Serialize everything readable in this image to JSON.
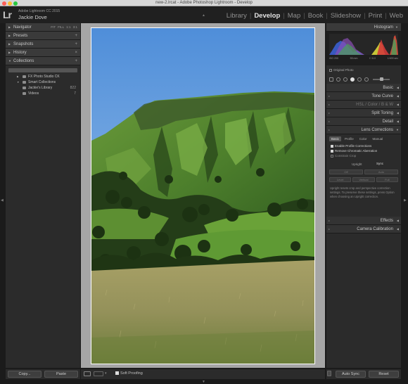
{
  "window": {
    "title": "new-2.lrcat - Adobe Photoshop Lightroom - Develop"
  },
  "identity": {
    "logo": "Lr",
    "app_name": "Adobe Lightroom CC 2015",
    "user_name": "Jackie Dove"
  },
  "modules": [
    "Library",
    "Develop",
    "Map",
    "Book",
    "Slideshow",
    "Print",
    "Web"
  ],
  "active_module": "Develop",
  "left_panel": {
    "navigator": {
      "label": "Navigator",
      "zoom_options": "FIT FILL 1:1 3:1"
    },
    "presets": {
      "label": "Presets",
      "action": "+"
    },
    "snapshots": {
      "label": "Snapshots",
      "action": "+"
    },
    "history": {
      "label": "History",
      "action": "×"
    },
    "collections": {
      "label": "Collections",
      "action": "+",
      "items": [
        {
          "label": "FX Photo Studio CK",
          "count": ""
        },
        {
          "label": "Smart Collections",
          "count": ""
        },
        {
          "label": "Jackie's Library",
          "count": "822"
        },
        {
          "label": "Videos",
          "count": "7"
        }
      ]
    }
  },
  "right_panel": {
    "histogram": {
      "label": "Histogram",
      "iso": "ISO 200",
      "focal_length": "55 mm",
      "aperture": "f / 6.0",
      "shutter": "1/400 sec",
      "original_photo": "Original Photo"
    },
    "sections": {
      "basic": "Basic",
      "tone_curve": "Tone Curve",
      "hsl": "HSL",
      "color": "Color",
      "bw": "B & W",
      "split_toning": "Split Toning",
      "detail": "Detail",
      "lens_corrections": "Lens Corrections",
      "effects": "Effects",
      "camera_calibration": "Camera Calibration"
    },
    "lens": {
      "tabs": [
        "Basic",
        "Profile",
        "Color",
        "Manual"
      ],
      "active_tab": "Basic",
      "checks": [
        {
          "label": "Enable Profile Corrections",
          "checked": true
        },
        {
          "label": "Remove Chromatic Aberration",
          "checked": true
        },
        {
          "label": "Constrain Crop",
          "checked": false
        }
      ],
      "upright_label": "Upright",
      "sync_label": "Sync",
      "upright_buttons": [
        "Off",
        "Auto",
        "Level",
        "Vertical",
        "Full"
      ],
      "help_text": "Upright resets crop and perspective correction settings. To preserve these settings, press Option when choosing an Upright correction."
    }
  },
  "bottom": {
    "copy": "Copy...",
    "paste": "Paste",
    "soft_proofing": "Soft Proofing",
    "auto_sync": "Auto Sync",
    "reset": "Reset"
  },
  "colors": {
    "panel_bg": "#2b2b2b",
    "active_module": "#e4e4e4",
    "histogram_blue": "#3b5fd0",
    "histogram_red": "#d23a3a",
    "histogram_yellow": "#d8d73a"
  }
}
